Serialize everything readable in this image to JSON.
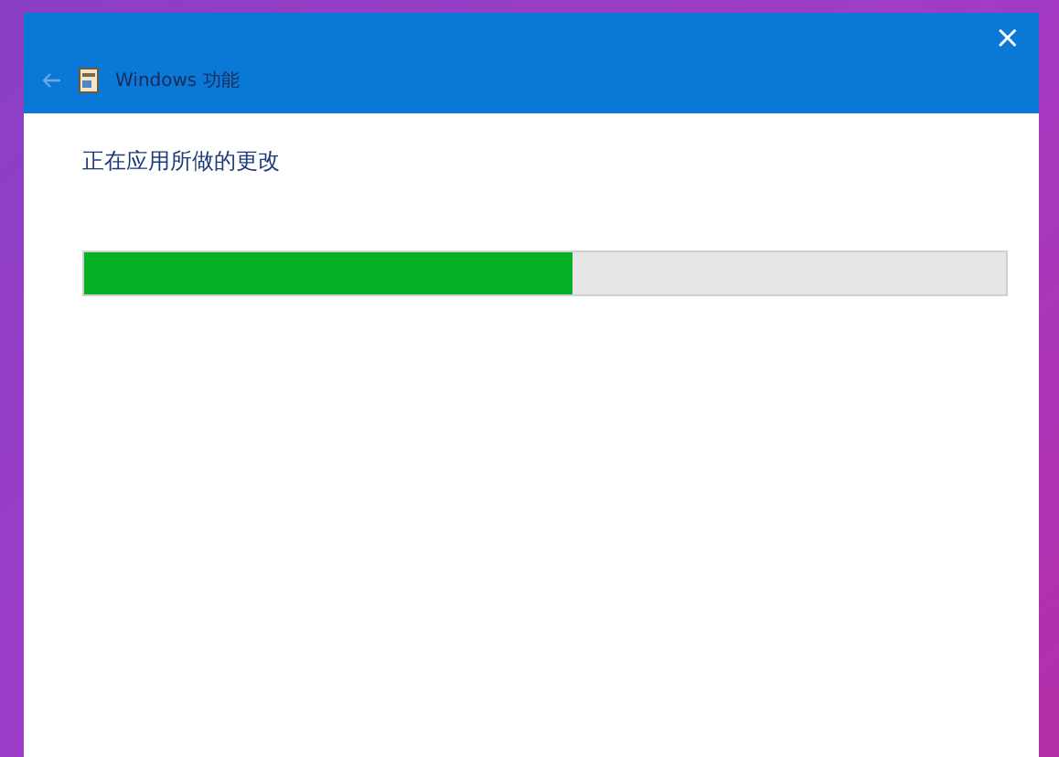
{
  "window": {
    "title": "Windows 功能",
    "close_icon": "×"
  },
  "heading": "正在应用所做的更改",
  "progress": {
    "level": 0.53
  }
}
